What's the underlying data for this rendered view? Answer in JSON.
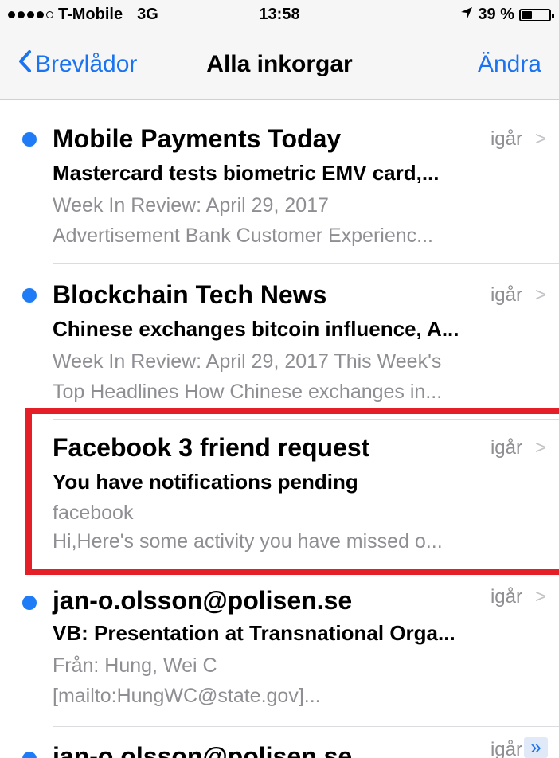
{
  "status_bar": {
    "carrier": "T-Mobile",
    "network": "3G",
    "time": "13:58",
    "battery": "39 %",
    "battery_level_pct": 39
  },
  "nav": {
    "back_label": "Brevlådor",
    "title": "Alla inkorgar",
    "edit_label": "Ändra"
  },
  "colors": {
    "accent": "#1a73f0",
    "unread_dot": "#1f7cf6",
    "highlight": "#e51f28"
  },
  "mails": [
    {
      "sender": "Mobile Payments Today",
      "date": "igår",
      "subject": "Mastercard tests biometric EMV card,...",
      "preview_line1": "Week In Review: April 29, 2017",
      "preview_line2": "Advertisement Bank Customer Experienc..."
    },
    {
      "sender": "Blockchain Tech News",
      "date": "igår",
      "subject": "Chinese exchanges bitcoin influence, A...",
      "preview_line1": "Week In Review: April 29, 2017 This Week's",
      "preview_line2": "Top Headlines How Chinese exchanges in..."
    },
    {
      "sender": "Facebook 3 friend request",
      "date": "igår",
      "subject": "You have notifications pending",
      "preview_line1": "facebook",
      "preview_line2": "Hi,Here's some activity you have missed o..."
    },
    {
      "sender": "jan-o.olsson@polisen.se",
      "date": "igår",
      "subject": "VB: Presentation at Transnational Orga...",
      "preview_line1": "Från: Hung, Wei C",
      "preview_line2": "[mailto:HungWC@state.gov]..."
    },
    {
      "sender": "jan-o.olsson@polisen.se",
      "date": "igår"
    }
  ]
}
